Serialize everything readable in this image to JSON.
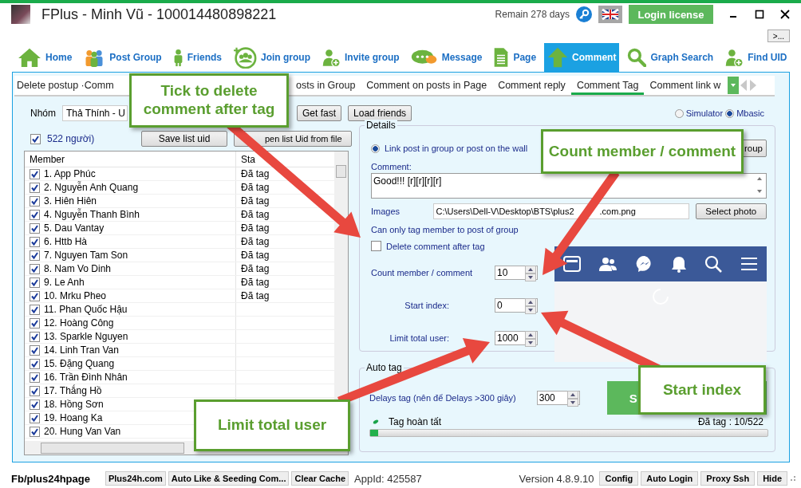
{
  "window": {
    "title": "FPlus - Minh Vũ - 100014480898221",
    "remain": "Remain 278 days",
    "license_button": "Login license",
    "more_button": ">..."
  },
  "nav": [
    {
      "label": "Home",
      "selected": false
    },
    {
      "label": "Post Group",
      "selected": false
    },
    {
      "label": "Friends",
      "selected": false
    },
    {
      "label": "Join group",
      "selected": false
    },
    {
      "label": "Invite group",
      "selected": false
    },
    {
      "label": "Message",
      "selected": false
    },
    {
      "label": "Page",
      "selected": false
    },
    {
      "label": "Comment",
      "selected": true
    },
    {
      "label": "Graph Search",
      "selected": false
    },
    {
      "label": "Find UID",
      "selected": false
    }
  ],
  "tabs": [
    {
      "label": "Delete postup ·Comm",
      "selected": false
    },
    {
      "label": "osts in Group",
      "selected": false
    },
    {
      "label": "Comment on posts in Page",
      "selected": false
    },
    {
      "label": "Comment reply",
      "selected": false
    },
    {
      "label": "Comment Tag",
      "selected": true
    },
    {
      "label": "Comment link w",
      "selected": false
    }
  ],
  "group": {
    "label": "Nhóm",
    "value": "Thả Thính - U",
    "get_fast": "Get fast",
    "load_friends": "Load friends"
  },
  "select_all": {
    "label": "522 người)",
    "checked": true,
    "save_button": "Save list uid",
    "open_button": "pen list Uid from file"
  },
  "table": {
    "columns": [
      "Member",
      "Sta"
    ],
    "rows": [
      {
        "name": "1. App Phúc",
        "checked": true,
        "status": "Đã tag"
      },
      {
        "name": "2. Nguyễn Anh Quang",
        "checked": true,
        "status": "Đã tag"
      },
      {
        "name": "3. Hiên Hiên",
        "checked": true,
        "status": "Đã tag"
      },
      {
        "name": "4. Nguyễn Thanh Bình",
        "checked": true,
        "status": "Đã tag"
      },
      {
        "name": "5. Dau Vantay",
        "checked": true,
        "status": "Đã tag"
      },
      {
        "name": "6. Httb Hà",
        "checked": true,
        "status": "Đã tag"
      },
      {
        "name": "7. Nguyen Tam Son",
        "checked": true,
        "status": "Đã tag"
      },
      {
        "name": "8. Nam Vo Dinh",
        "checked": true,
        "status": "Đã tag"
      },
      {
        "name": "9. Le Anh",
        "checked": true,
        "status": "Đã tag"
      },
      {
        "name": "10. Mrku Pheo",
        "checked": true,
        "status": "Đã tag"
      },
      {
        "name": "11. Phan Quốc Hậu",
        "checked": true
      },
      {
        "name": "12. Hoàng Công",
        "checked": true
      },
      {
        "name": "13. Sparkle Nguyen",
        "checked": true
      },
      {
        "name": "14. Linh Tran Van",
        "checked": true
      },
      {
        "name": "15. Đặng Quang",
        "checked": true
      },
      {
        "name": "16. Trần Đình Nhân",
        "checked": true
      },
      {
        "name": "17. Thắng Hồ",
        "checked": true
      },
      {
        "name": "18. Hồng Sơn",
        "checked": true
      },
      {
        "name": "19. Hoang Ka",
        "checked": true
      },
      {
        "name": "20. Hung Van Van",
        "checked": true
      }
    ]
  },
  "mode": [
    {
      "label": "Simulator",
      "selected": false
    },
    {
      "label": "Mbasic",
      "selected": true
    }
  ],
  "details": {
    "legend": "Details",
    "link_radio": {
      "label": "Link post in group or post on the wall",
      "selected": true
    },
    "group_button": "roup",
    "comment_label": "Comment:",
    "comment": "Good!!! [r][r][r][r]",
    "images_label": "Images",
    "images_path": "C:\\Users\\Dell-V\\Desktop\\BTS\\plus2",
    "images_path_end": ".com.png",
    "select_photo": "Select photo",
    "note": "Can only tag member to post of group",
    "delete_after": {
      "label": "Delete comment after tag",
      "checked": false
    },
    "spinners": [
      {
        "label": "Count member / comment",
        "value": "10"
      },
      {
        "label": "Start index:",
        "value": "0"
      },
      {
        "label": "Limit total user:",
        "value": "1000"
      }
    ]
  },
  "auto_tag": {
    "legend": "Auto tag",
    "delay_label": "Delays tag (nên để Delays >300  giây)",
    "delay": "300",
    "start_button": "S",
    "status": "Tag hoàn tất",
    "count": "Đã tag : 10/522",
    "level": 0.02
  },
  "callouts": [
    "Tick to delete comment after tag",
    "Count member / comment",
    "Start index",
    "Limit total user"
  ],
  "footer": {
    "page": "Fb/plus24hpage",
    "buttons_left": [
      "Plus24h.com",
      "Auto Like & Seeding Com...",
      "Clear Cache"
    ],
    "app_id": "AppId: 425587",
    "version": "Version 4.8.9.10",
    "buttons_right": [
      "Config",
      "Auto Login",
      "Proxy Ssh",
      "Hide"
    ]
  }
}
